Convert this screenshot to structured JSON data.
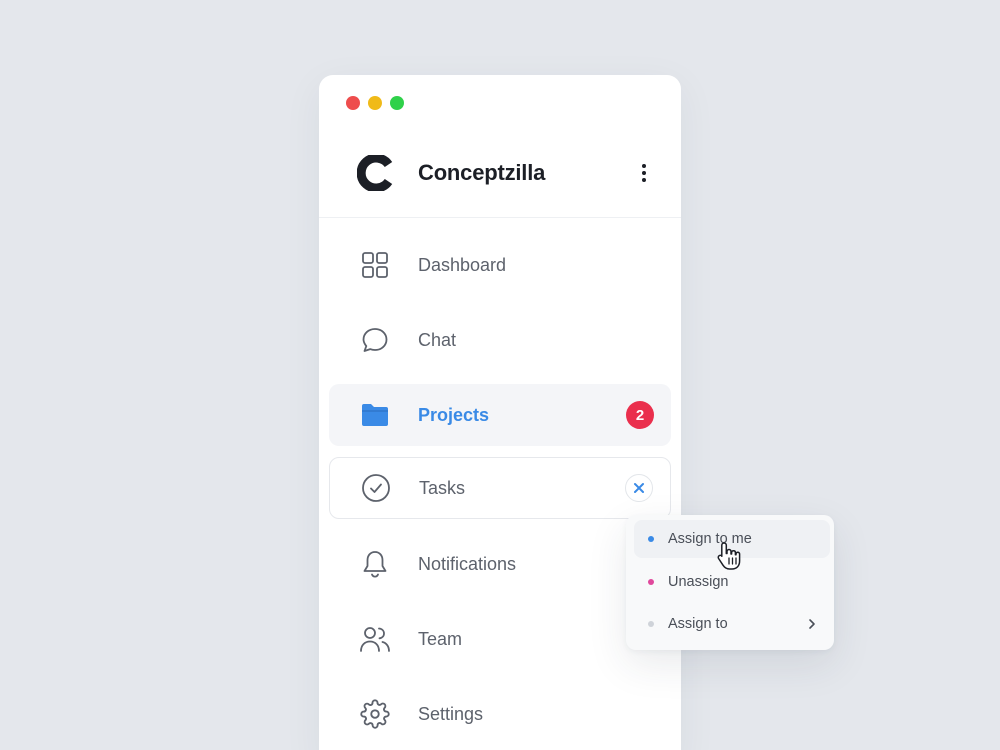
{
  "app": {
    "name": "Conceptzilla"
  },
  "nav": {
    "items": [
      {
        "label": "Dashboard",
        "icon": "grid-icon"
      },
      {
        "label": "Chat",
        "icon": "chat-bubble-icon"
      },
      {
        "label": "Projects",
        "icon": "folder-icon",
        "badge": "2",
        "active": true
      },
      {
        "label": "Tasks",
        "icon": "check-circle-icon"
      },
      {
        "label": "Notifications",
        "icon": "bell-icon"
      },
      {
        "label": "Team",
        "icon": "users-icon"
      },
      {
        "label": "Settings",
        "icon": "gear-icon"
      }
    ]
  },
  "context_menu": {
    "items": [
      {
        "label": "Assign to me",
        "dot_color": "#3a8ae6"
      },
      {
        "label": "Unassign",
        "dot_color": "#e0489c"
      },
      {
        "label": "Assign to",
        "dot_color": "#cfd3d9"
      }
    ]
  },
  "colors": {
    "accent": "#3a8ae6",
    "badge": "#ea2f4d",
    "background": "#e4e7ec"
  }
}
